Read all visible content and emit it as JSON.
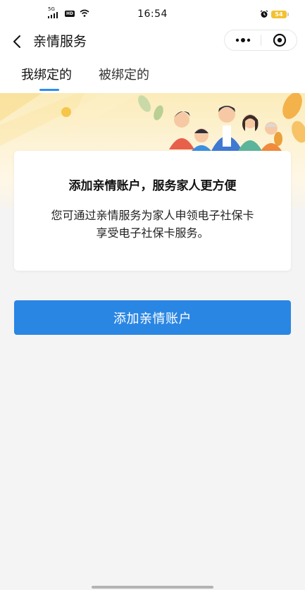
{
  "status_bar": {
    "network": "5G",
    "hd": "HD",
    "time": "16:54",
    "battery": "54"
  },
  "nav": {
    "title": "亲情服务",
    "back_icon": "chevron-left-icon",
    "more_icon": "more-dots-icon",
    "close_icon": "target-close-icon"
  },
  "tabs": [
    {
      "label": "我绑定的",
      "active": true
    },
    {
      "label": "被绑定的",
      "active": false
    }
  ],
  "card": {
    "title": "添加亲情账户，服务家人更方便",
    "desc_line1": "您可通过亲情服务为家人申领电子社保卡",
    "desc_line2": "享受电子社保卡服务。"
  },
  "primary_button": {
    "label": "添加亲情账户"
  },
  "colors": {
    "accent": "#2a86e3",
    "tab_indicator": "#2b8ff0",
    "battery": "#f2c230",
    "page_bg": "#f4f4f4"
  }
}
